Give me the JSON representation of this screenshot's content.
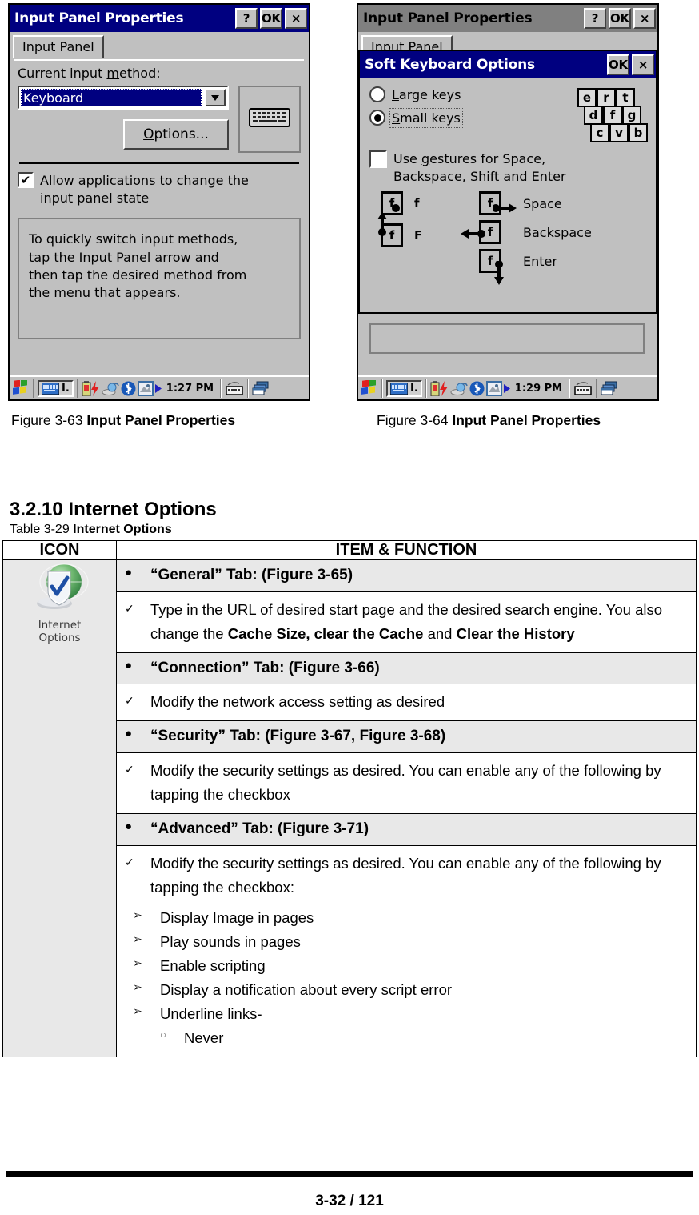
{
  "figures": [
    {
      "id": "fig-3-63",
      "caption_prefix": "Figure 3-63",
      "caption_bold": "Input Panel Properties",
      "window": {
        "title": "Input Panel Properties",
        "titlebar_state": "active",
        "buttons": [
          "?",
          "OK",
          "×"
        ],
        "tab_label": "Input Panel",
        "field_label": "Current input method:",
        "combo_value": "Keyboard",
        "combo_arrow_icon": "chevron-down-icon",
        "options_button": "Options...",
        "preview_icon": "keyboard-icon",
        "checkbox": {
          "checked": true,
          "check_glyph": "✔",
          "label_line1": "Allow applications to change the",
          "label_line2": "input panel state"
        },
        "hint_lines": [
          "To quickly switch input methods,",
          "tap the Input Panel arrow and",
          "then tap the desired method from",
          "the menu that appears."
        ],
        "taskbar": {
          "time": "1:27 PM",
          "start_icon": "windows-start-icon",
          "input_panel_icon": "input-panel-icon",
          "input_panel_label": "I.",
          "tray_icons": [
            "battery-icon",
            "power-icon",
            "network-icon",
            "bluetooth-icon",
            "display-icon"
          ],
          "overflow_icon": "chevron-right-icon",
          "keyboard_icon": "soft-keyboard-icon",
          "windows_icon": "desktop-windows-icon"
        }
      }
    },
    {
      "id": "fig-3-64",
      "caption_prefix": "Figure 3-64",
      "caption_bold": "Input Panel Properties",
      "window": {
        "title": "Input Panel Properties",
        "titlebar_state": "inactive",
        "buttons": [
          "?",
          "OK",
          "×"
        ],
        "tab_label": "Input Panel",
        "taskbar": {
          "time": "1:29 PM",
          "start_icon": "windows-start-icon",
          "input_panel_icon": "input-panel-icon",
          "input_panel_label": "I.",
          "tray_icons": [
            "battery-icon",
            "power-icon",
            "network-icon",
            "bluetooth-icon",
            "display-icon"
          ],
          "overflow_icon": "chevron-right-icon",
          "keyboard_icon": "soft-keyboard-icon",
          "windows_icon": "desktop-windows-icon"
        }
      },
      "dialog": {
        "title": "Soft Keyboard Options",
        "titlebar_state": "active",
        "buttons": [
          "OK",
          "×"
        ],
        "radios": [
          {
            "label": "Large keys",
            "underline": "L",
            "selected": false
          },
          {
            "label": "Small keys",
            "underline": "S",
            "selected": true
          }
        ],
        "key_preview_rows": [
          [
            "e",
            "r",
            "t"
          ],
          [
            "d",
            "f",
            "g"
          ],
          [
            "c",
            "v",
            "b"
          ]
        ],
        "gesture_checkbox": {
          "checked": false,
          "label_line1": "Use gestures for Space,",
          "label_line2": "Backspace, Shift and Enter"
        },
        "gesture_left": [
          {
            "key": "f",
            "result": "f",
            "direction": "down-right-dot"
          },
          {
            "key": "f",
            "result": "F",
            "direction": "up"
          }
        ],
        "gesture_right": [
          {
            "key": "f",
            "label": "Space",
            "direction": "right"
          },
          {
            "key": "f",
            "label": "Backspace",
            "direction": "left"
          },
          {
            "key": "f",
            "label": "Enter",
            "direction": "down"
          }
        ]
      }
    }
  ],
  "section": {
    "number": "3.2.10",
    "title": "Internet Options",
    "heading": "3.2.10 Internet Options",
    "table_caption_prefix": "Table 3-29",
    "table_caption_bold": "Internet Options"
  },
  "table": {
    "headers": [
      "ICON",
      "ITEM & FUNCTION"
    ],
    "icon": {
      "name": "internet-options-icon",
      "caption_line1": "Internet",
      "caption_line2": "Options"
    },
    "rows": [
      {
        "type": "tab",
        "marker": "●",
        "text": "“General” Tab: (Figure 3-65)"
      },
      {
        "type": "check",
        "marker": "✓",
        "segments": [
          {
            "text": "Type in the URL of desired start page and the desired search engine. You also change the ",
            "bold": false
          },
          {
            "text": "Cache Size, clear the Cache",
            "bold": true
          },
          {
            "text": " and ",
            "bold": false
          },
          {
            "text": "Clear the History",
            "bold": true
          }
        ]
      },
      {
        "type": "tab",
        "marker": "●",
        "text": "“Connection” Tab: (Figure 3-66)"
      },
      {
        "type": "check",
        "marker": "✓",
        "segments": [
          {
            "text": "Modify the network access setting as desired",
            "bold": false
          }
        ]
      },
      {
        "type": "tab",
        "marker": "●",
        "text": "“Security” Tab: (Figure 3-67, Figure 3-68)"
      },
      {
        "type": "check",
        "marker": "✓",
        "segments": [
          {
            "text": "Modify the security settings as desired. You can enable any of the following by tapping the checkbox",
            "bold": false
          }
        ]
      },
      {
        "type": "tab",
        "marker": "●",
        "text": "“Advanced” Tab: (Figure 3-71)"
      },
      {
        "type": "check-with-sublist",
        "marker": "✓",
        "segments": [
          {
            "text": "Modify the security settings as desired. You can enable any of the following by tapping the checkbox:",
            "bold": false
          }
        ],
        "sub_marker": "➢",
        "sub_items": [
          "Display Image in pages",
          "Play sounds in pages",
          "Enable scripting",
          "Display a notification about every script error",
          "Underline links-"
        ],
        "sub2_marker": "○",
        "sub2_items": [
          "Never"
        ]
      }
    ]
  },
  "footer": {
    "page": "3-32 / 121"
  }
}
